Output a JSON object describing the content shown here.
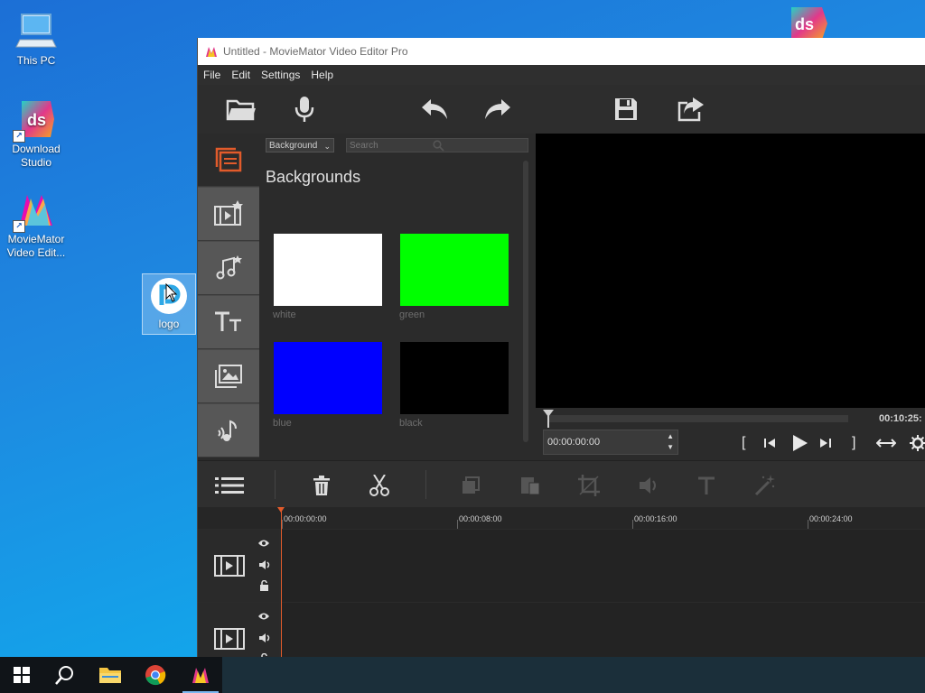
{
  "desktop": {
    "icons": [
      {
        "label": "This PC"
      },
      {
        "label": "Download Studio",
        "badge_text": "ds"
      },
      {
        "label": "MovieMator Video Edit..."
      },
      {
        "label": "logo"
      }
    ],
    "corner_badge": "ds"
  },
  "window": {
    "title": "Untitled - MovieMator Video Editor Pro",
    "menu": [
      "File",
      "Edit",
      "Settings",
      "Help"
    ],
    "toolbar_icons": [
      "open-folder-icon",
      "microphone-icon",
      "undo-icon",
      "redo-icon",
      "save-icon",
      "export-icon"
    ],
    "side_tabs": [
      "library-icon",
      "video-effects-icon",
      "music-icon",
      "text-icon",
      "overlays-icon",
      "sound-effects-icon"
    ]
  },
  "library": {
    "category_select": "Background",
    "search_placeholder": "Search",
    "heading": "Backgrounds",
    "items": [
      {
        "label": "white",
        "color": "#ffffff"
      },
      {
        "label": "green",
        "color": "#00ff00"
      },
      {
        "label": "blue",
        "color": "#0000ff"
      },
      {
        "label": "black",
        "color": "#000000"
      }
    ]
  },
  "preview": {
    "duration": "00:10:25:",
    "timecode": "00:00:00:00",
    "controls": [
      "[",
      "]"
    ]
  },
  "timeline": {
    "ruler_labels": [
      "00:00:00:00",
      "00:00:08:00",
      "00:00:16:00",
      "00:00:24:00"
    ],
    "tools": [
      "menu-icon",
      "delete-icon",
      "cut-icon",
      "copy-icon",
      "paste-icon",
      "crop-icon",
      "volume-icon",
      "text-icon",
      "magic-wand-icon"
    ]
  },
  "colors": {
    "accent": "#e25b2b",
    "window_bg": "#2b2b2b"
  }
}
